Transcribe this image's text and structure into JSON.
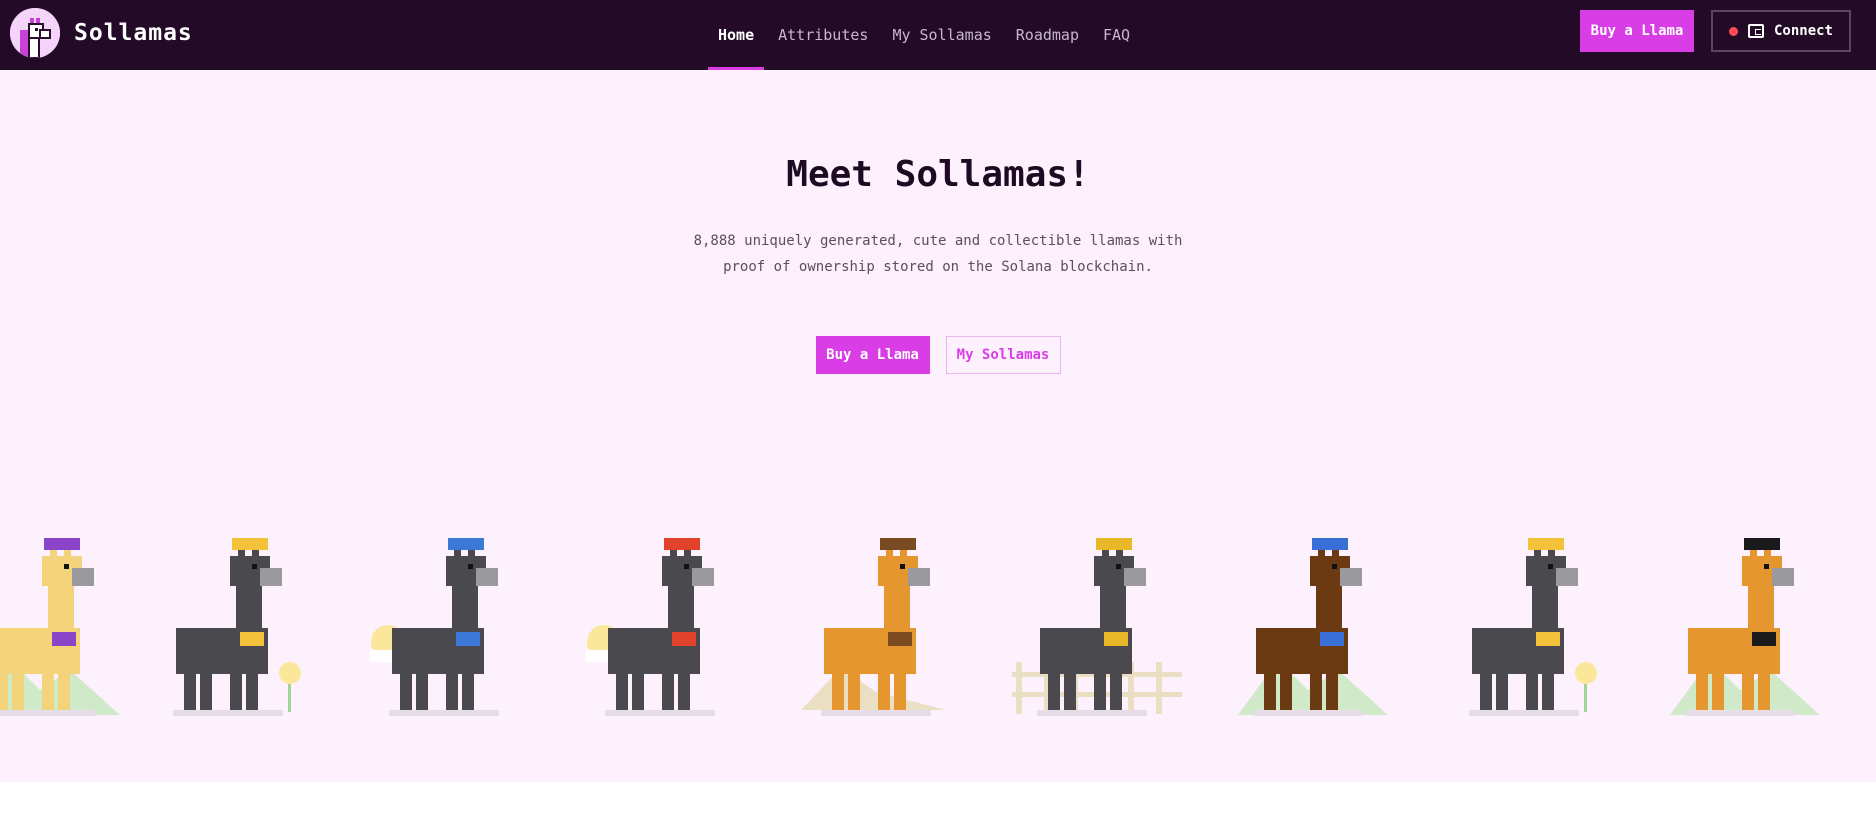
{
  "nav": {
    "brand": "Sollamas",
    "logo_icon": "llama-logo-icon",
    "links": [
      {
        "label": "Home",
        "active": true
      },
      {
        "label": "Attributes",
        "active": false
      },
      {
        "label": "My Sollamas",
        "active": false
      },
      {
        "label": "Roadmap",
        "active": false
      },
      {
        "label": "FAQ",
        "active": false
      }
    ],
    "buy_label": "Buy a Llama",
    "connect_label": "Connect",
    "connect_status": "disconnected",
    "wallet_icon": "wallet-icon"
  },
  "hero": {
    "title": "Meet Sollamas!",
    "description_line1": "8,888 uniquely generated, cute and collectible llamas with",
    "description_line2": "proof of ownership stored on the Solana blockchain.",
    "buy_label": "Buy a Llama",
    "my_label": "My Sollamas"
  },
  "llamas": [
    {
      "name": "llama-yellow-straw-hat",
      "body": "#f3d47a",
      "accent": "#8a44c8",
      "scene": "mountains"
    },
    {
      "name": "llama-gray-unicorn",
      "body": "#4a4a4e",
      "accent": "#f3c23a",
      "scene": "flower"
    },
    {
      "name": "llama-gray-party-hat",
      "body": "#4a4a4e",
      "accent": "#3b78d8",
      "scene": "sun"
    },
    {
      "name": "llama-gray-propeller",
      "body": "#4a4a4e",
      "accent": "#e0422c",
      "scene": "sun"
    },
    {
      "name": "llama-orange-beanie",
      "body": "#e5962e",
      "accent": "#7a4a20",
      "scene": "desert"
    },
    {
      "name": "llama-gray-pipe",
      "body": "#4a4a4e",
      "accent": "#e8b828",
      "scene": "fence"
    },
    {
      "name": "llama-brown-cap",
      "body": "#6b3a12",
      "accent": "#3b6fd8",
      "scene": "mountains"
    },
    {
      "name": "llama-gray-arrow",
      "body": "#4a4a4e",
      "accent": "#f3c23a",
      "scene": "flower"
    },
    {
      "name": "llama-orange-top-hat",
      "body": "#e5962e",
      "accent": "#1a1a1a",
      "scene": "mountains"
    }
  ],
  "colors": {
    "accent": "#d93ee6",
    "nav_bg": "#230b28",
    "hero_bg": "#fdf1fd"
  }
}
